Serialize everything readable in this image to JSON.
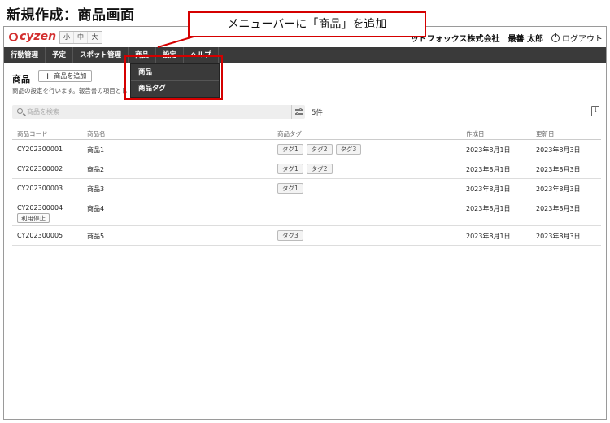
{
  "page_heading": "新規作成：商品画面",
  "callout": "メニューバーに「商品」を追加",
  "header": {
    "logo": "cyzen",
    "font_sizes": [
      "小",
      "中",
      "大"
    ],
    "company": "ッドフォックス株式会社",
    "user": "最善 太郎",
    "logout": "ログアウト"
  },
  "nav": {
    "items": [
      "行動管理",
      "予定",
      "スポット管理",
      "商品",
      "設定",
      "ヘルプ"
    ]
  },
  "dropdown": {
    "items": [
      "商品",
      "商品タグ"
    ]
  },
  "main": {
    "title": "商品",
    "add_button": "商品を追加",
    "description": "商品の設定を行います。報告書の項目とし",
    "search_placeholder": "商品を検索",
    "count": "5件"
  },
  "table": {
    "headers": [
      "商品コード",
      "商品名",
      "商品タグ",
      "作成日",
      "更新日"
    ],
    "rows": [
      {
        "code": "CY202300001",
        "name": "商品1",
        "tags": [
          "タグ1",
          "タグ2",
          "タグ3"
        ],
        "created": "2023年8月1日",
        "updated": "2023年8月3日",
        "status": ""
      },
      {
        "code": "CY202300002",
        "name": "商品2",
        "tags": [
          "タグ1",
          "タグ2"
        ],
        "created": "2023年8月1日",
        "updated": "2023年8月3日",
        "status": ""
      },
      {
        "code": "CY202300003",
        "name": "商品3",
        "tags": [
          "タグ1"
        ],
        "created": "2023年8月1日",
        "updated": "2023年8月3日",
        "status": ""
      },
      {
        "code": "CY202300004",
        "name": "商品4",
        "tags": [],
        "created": "2023年8月1日",
        "updated": "2023年8月3日",
        "status": "利用停止"
      },
      {
        "code": "CY202300005",
        "name": "商品5",
        "tags": [
          "タグ3"
        ],
        "created": "2023年8月1日",
        "updated": "2023年8月3日",
        "status": ""
      }
    ]
  },
  "colors": {
    "brand": "#d32f2f",
    "nav_bg": "#3a3a3a",
    "highlight": "#d50000"
  }
}
